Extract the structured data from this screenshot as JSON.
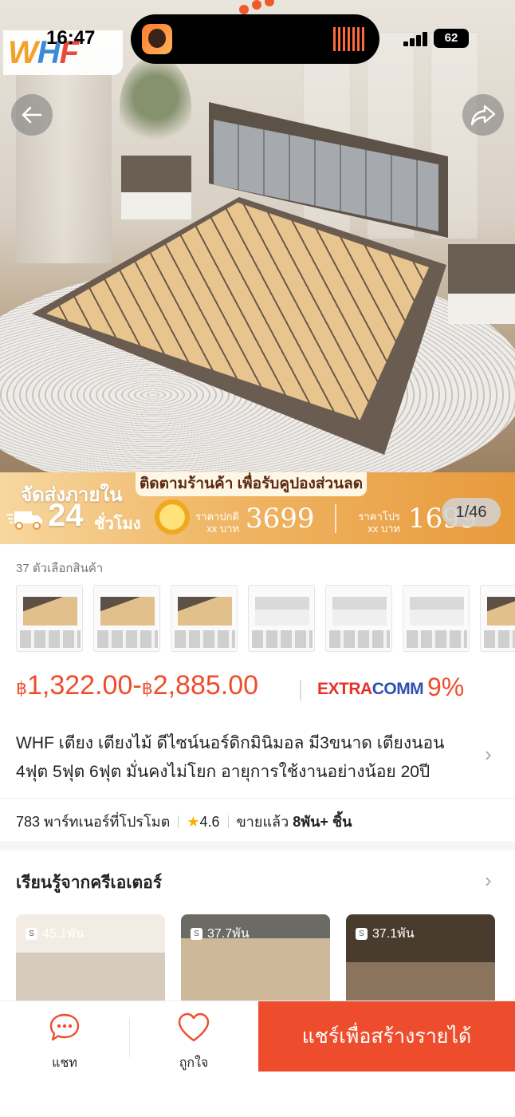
{
  "status_bar": {
    "time": "16:47",
    "battery": "62"
  },
  "logo": {
    "part1": "W",
    "part2": "H",
    "part3": "F"
  },
  "hero": {
    "image_counter": "1/46"
  },
  "banner": {
    "ship_line1": "จัดส่งภายใน",
    "ship_number": "24",
    "ship_unit": "ชั่วโมง",
    "follow_text": "ติดตามร้านค้า เพื่อรับคูปองส่วนลด",
    "normal_price_label1": "ราคาปกติ",
    "normal_price_label2": "xx บาท",
    "normal_price": "3699",
    "promo_price_label1": "ราคาโปร",
    "promo_price_label2": "xx บาท",
    "promo_price": "1699"
  },
  "options": {
    "label": "37 ตัวเลือกสินค้า"
  },
  "price": {
    "min_currency": "฿",
    "min_amount": "1,322.00",
    "dash": "-",
    "max_currency": "฿",
    "max_amount": "2,885.00",
    "extra": "EXTRA",
    "comm": "COMM",
    "comm_pct": "9%"
  },
  "product": {
    "title": "WHF เตียง เตียงไม้ ดีไซน์นอร์ดิกมินิมอล มี3ขนาด เตียงนอน 4ฟุต 5ฟุต 6ฟุต มั่นคงไม่โยก อายุการใช้งานอย่างน้อย 20ปี"
  },
  "meta": {
    "partners": "783 พาร์ทเนอร์ที่โปรโมต",
    "rating": "4.6",
    "sold_label": "ขายแล้ว",
    "sold_value": "8พัน+ ชิ้น"
  },
  "creators": {
    "title": "เรียนรู้จากครีเอเตอร์",
    "videos": [
      {
        "views": "45.1พัน"
      },
      {
        "views": "37.7พัน"
      },
      {
        "views": "37.1พัน"
      }
    ]
  },
  "bottom_bar": {
    "chat_label": "แชท",
    "like_label": "ถูกใจ",
    "share_earn_label": "แชร์เพื่อสร้างรายได้"
  },
  "colors": {
    "accent": "#ee4d2d",
    "comm_blue": "#2d4fb0",
    "star": "#f5b301"
  },
  "icons": [
    "back-arrow-icon",
    "share-icon",
    "chat-icon",
    "heart-icon",
    "chevron-right-icon",
    "play-icon",
    "star-icon",
    "truck-icon",
    "coin-icon"
  ]
}
